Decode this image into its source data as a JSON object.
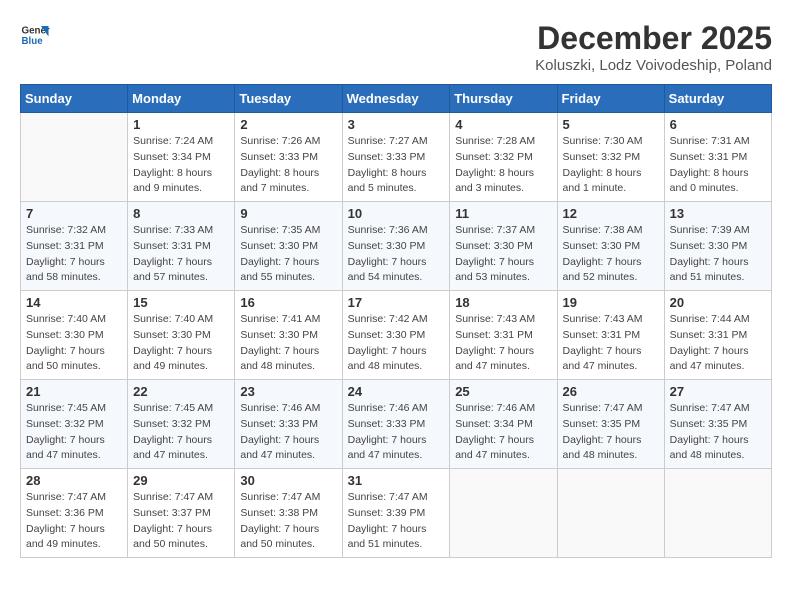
{
  "logo": {
    "line1": "General",
    "line2": "Blue"
  },
  "title": {
    "month_year": "December 2025",
    "location": "Koluszki, Lodz Voivodeship, Poland"
  },
  "header_days": [
    "Sunday",
    "Monday",
    "Tuesday",
    "Wednesday",
    "Thursday",
    "Friday",
    "Saturday"
  ],
  "weeks": [
    [
      {
        "day": "",
        "info": ""
      },
      {
        "day": "1",
        "info": "Sunrise: 7:24 AM\nSunset: 3:34 PM\nDaylight: 8 hours\nand 9 minutes."
      },
      {
        "day": "2",
        "info": "Sunrise: 7:26 AM\nSunset: 3:33 PM\nDaylight: 8 hours\nand 7 minutes."
      },
      {
        "day": "3",
        "info": "Sunrise: 7:27 AM\nSunset: 3:33 PM\nDaylight: 8 hours\nand 5 minutes."
      },
      {
        "day": "4",
        "info": "Sunrise: 7:28 AM\nSunset: 3:32 PM\nDaylight: 8 hours\nand 3 minutes."
      },
      {
        "day": "5",
        "info": "Sunrise: 7:30 AM\nSunset: 3:32 PM\nDaylight: 8 hours\nand 1 minute."
      },
      {
        "day": "6",
        "info": "Sunrise: 7:31 AM\nSunset: 3:31 PM\nDaylight: 8 hours\nand 0 minutes."
      }
    ],
    [
      {
        "day": "7",
        "info": "Sunrise: 7:32 AM\nSunset: 3:31 PM\nDaylight: 7 hours\nand 58 minutes."
      },
      {
        "day": "8",
        "info": "Sunrise: 7:33 AM\nSunset: 3:31 PM\nDaylight: 7 hours\nand 57 minutes."
      },
      {
        "day": "9",
        "info": "Sunrise: 7:35 AM\nSunset: 3:30 PM\nDaylight: 7 hours\nand 55 minutes."
      },
      {
        "day": "10",
        "info": "Sunrise: 7:36 AM\nSunset: 3:30 PM\nDaylight: 7 hours\nand 54 minutes."
      },
      {
        "day": "11",
        "info": "Sunrise: 7:37 AM\nSunset: 3:30 PM\nDaylight: 7 hours\nand 53 minutes."
      },
      {
        "day": "12",
        "info": "Sunrise: 7:38 AM\nSunset: 3:30 PM\nDaylight: 7 hours\nand 52 minutes."
      },
      {
        "day": "13",
        "info": "Sunrise: 7:39 AM\nSunset: 3:30 PM\nDaylight: 7 hours\nand 51 minutes."
      }
    ],
    [
      {
        "day": "14",
        "info": "Sunrise: 7:40 AM\nSunset: 3:30 PM\nDaylight: 7 hours\nand 50 minutes."
      },
      {
        "day": "15",
        "info": "Sunrise: 7:40 AM\nSunset: 3:30 PM\nDaylight: 7 hours\nand 49 minutes."
      },
      {
        "day": "16",
        "info": "Sunrise: 7:41 AM\nSunset: 3:30 PM\nDaylight: 7 hours\nand 48 minutes."
      },
      {
        "day": "17",
        "info": "Sunrise: 7:42 AM\nSunset: 3:30 PM\nDaylight: 7 hours\nand 48 minutes."
      },
      {
        "day": "18",
        "info": "Sunrise: 7:43 AM\nSunset: 3:31 PM\nDaylight: 7 hours\nand 47 minutes."
      },
      {
        "day": "19",
        "info": "Sunrise: 7:43 AM\nSunset: 3:31 PM\nDaylight: 7 hours\nand 47 minutes."
      },
      {
        "day": "20",
        "info": "Sunrise: 7:44 AM\nSunset: 3:31 PM\nDaylight: 7 hours\nand 47 minutes."
      }
    ],
    [
      {
        "day": "21",
        "info": "Sunrise: 7:45 AM\nSunset: 3:32 PM\nDaylight: 7 hours\nand 47 minutes."
      },
      {
        "day": "22",
        "info": "Sunrise: 7:45 AM\nSunset: 3:32 PM\nDaylight: 7 hours\nand 47 minutes."
      },
      {
        "day": "23",
        "info": "Sunrise: 7:46 AM\nSunset: 3:33 PM\nDaylight: 7 hours\nand 47 minutes."
      },
      {
        "day": "24",
        "info": "Sunrise: 7:46 AM\nSunset: 3:33 PM\nDaylight: 7 hours\nand 47 minutes."
      },
      {
        "day": "25",
        "info": "Sunrise: 7:46 AM\nSunset: 3:34 PM\nDaylight: 7 hours\nand 47 minutes."
      },
      {
        "day": "26",
        "info": "Sunrise: 7:47 AM\nSunset: 3:35 PM\nDaylight: 7 hours\nand 48 minutes."
      },
      {
        "day": "27",
        "info": "Sunrise: 7:47 AM\nSunset: 3:35 PM\nDaylight: 7 hours\nand 48 minutes."
      }
    ],
    [
      {
        "day": "28",
        "info": "Sunrise: 7:47 AM\nSunset: 3:36 PM\nDaylight: 7 hours\nand 49 minutes."
      },
      {
        "day": "29",
        "info": "Sunrise: 7:47 AM\nSunset: 3:37 PM\nDaylight: 7 hours\nand 50 minutes."
      },
      {
        "day": "30",
        "info": "Sunrise: 7:47 AM\nSunset: 3:38 PM\nDaylight: 7 hours\nand 50 minutes."
      },
      {
        "day": "31",
        "info": "Sunrise: 7:47 AM\nSunset: 3:39 PM\nDaylight: 7 hours\nand 51 minutes."
      },
      {
        "day": "",
        "info": ""
      },
      {
        "day": "",
        "info": ""
      },
      {
        "day": "",
        "info": ""
      }
    ]
  ]
}
